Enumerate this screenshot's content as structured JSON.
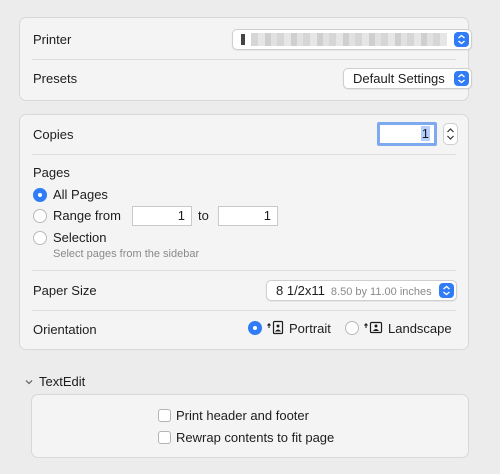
{
  "printer": {
    "label": "Printer",
    "value_redacted": true
  },
  "presets": {
    "label": "Presets",
    "value": "Default Settings"
  },
  "copies": {
    "label": "Copies",
    "value": "1"
  },
  "pages": {
    "label": "Pages",
    "all_pages": "All Pages",
    "range_from": "Range from",
    "range_start": "1",
    "range_to": "to",
    "range_end": "1",
    "selection": "Selection",
    "selection_hint": "Select pages from the sidebar",
    "selected_option": "all_pages"
  },
  "paper_size": {
    "label": "Paper Size",
    "value": "8 1/2x11",
    "detail": "8.50 by 11.00 inches"
  },
  "orientation": {
    "label": "Orientation",
    "portrait": "Portrait",
    "landscape": "Landscape",
    "selected": "portrait"
  },
  "textedit": {
    "section_label": "TextEdit",
    "print_header_footer": "Print header and footer",
    "print_header_footer_checked": false,
    "rewrap_contents": "Rewrap contents to fit page",
    "rewrap_contents_checked": false
  },
  "colors": {
    "accent": "#2f7cf6",
    "panel": "#f4f4f4",
    "background": "#ececec"
  }
}
